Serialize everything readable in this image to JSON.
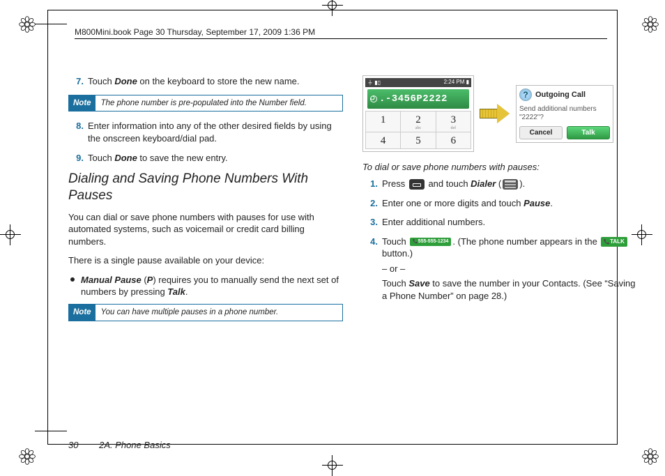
{
  "header": "M800Mini.book  Page 30  Thursday, September 17, 2009  1:36 PM",
  "left": {
    "step7": {
      "n": "7.",
      "pre": "Touch ",
      "b": "Done",
      "post": " on the keyboard to store the new name."
    },
    "note1": {
      "label": "Note",
      "text": "The phone number is pre-populated into the Number field."
    },
    "step8": {
      "n": "8.",
      "text": "Enter information into any of the other desired fields by using the onscreen keyboard/dial pad."
    },
    "step9": {
      "n": "9.",
      "pre": "Touch ",
      "b": "Done",
      "post": " to save the new entry."
    },
    "h2": "Dialing and Saving Phone Numbers With Pauses",
    "p1": "You can dial or save phone numbers with pauses for use with automated systems, such as voicemail or credit card billing numbers.",
    "p2": "There is a single pause available on your device:",
    "bullet": {
      "b1": "Manual Pause",
      "mid1": " (",
      "b2": "P",
      "mid2": ") requires you to manually send the next set of numbers by pressing ",
      "b3": "Talk",
      "tail": "."
    },
    "note2": {
      "label": "Note",
      "text": "You can have multiple pauses in a phone number."
    }
  },
  "figure": {
    "status_left": "⏚  ▮▯",
    "status_right": "2:24 PM ▮",
    "number_display": ".-3456P2222",
    "keys": [
      {
        "d": "1",
        "s": ""
      },
      {
        "d": "2",
        "s": "abc"
      },
      {
        "d": "3",
        "s": "def"
      },
      {
        "d": "4",
        "s": ""
      },
      {
        "d": "5",
        "s": ""
      },
      {
        "d": "6",
        "s": ""
      }
    ],
    "popup": {
      "title": "Outgoing Call",
      "body": "Send additional numbers \"2222\"?",
      "cancel": "Cancel",
      "talk": "Talk"
    }
  },
  "right": {
    "intro": "To dial or save phone numbers with pauses:",
    "s1": {
      "n": "1.",
      "pre": "Press ",
      "mid": " and touch ",
      "b": "Dialer",
      "open": " (",
      "close": ")."
    },
    "s2": {
      "n": "2.",
      "pre": "Enter one or more digits and touch ",
      "b": "Pause",
      "post": "."
    },
    "s3": {
      "n": "3.",
      "text": "Enter additional numbers."
    },
    "s4": {
      "n": "4.",
      "pre": "Touch ",
      "badge1": "555-555-1234",
      "mid1": ". (The phone number appears in the ",
      "badge2": "TALK",
      "mid2": " button.)",
      "or": "– or –",
      "line2a": "Touch ",
      "b": "Save",
      "line2b": " to save the number in your Contacts. (See “Saving a Phone Number” on page 28.)"
    }
  },
  "footer": {
    "page": "30",
    "section": "2A. Phone Basics"
  }
}
